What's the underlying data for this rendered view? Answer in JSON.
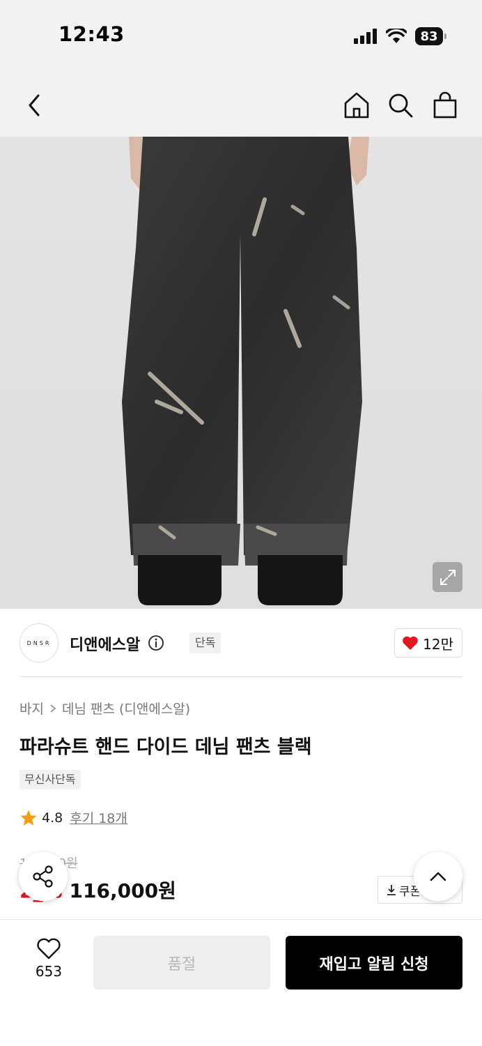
{
  "status_bar": {
    "time": "12:43",
    "battery": "83"
  },
  "brand": {
    "logo_text": "DNSR",
    "name": "디앤에스알",
    "exclusive_label": "단독",
    "like_count": "12만"
  },
  "breadcrumb": {
    "category": "바지",
    "subcategory": "데님 팬츠 (디앤에스알)"
  },
  "product": {
    "title": "파라슈트 핸드 다이드 데님 팬츠 블랙",
    "tag": "무신사단독",
    "rating": "4.8",
    "review_label": "후기 18개",
    "original_price": "1__,_00원",
    "discount": "2_%",
    "price": "116,000원",
    "coupon_label": "쿠폰"
  },
  "bottom_bar": {
    "wish_count": "653",
    "soldout_label": "품절",
    "restock_label": "재입고 알림 신청"
  },
  "colors": {
    "accent_red": "#e4151f",
    "heart": "#e4151f",
    "star": "#f59e0b"
  }
}
